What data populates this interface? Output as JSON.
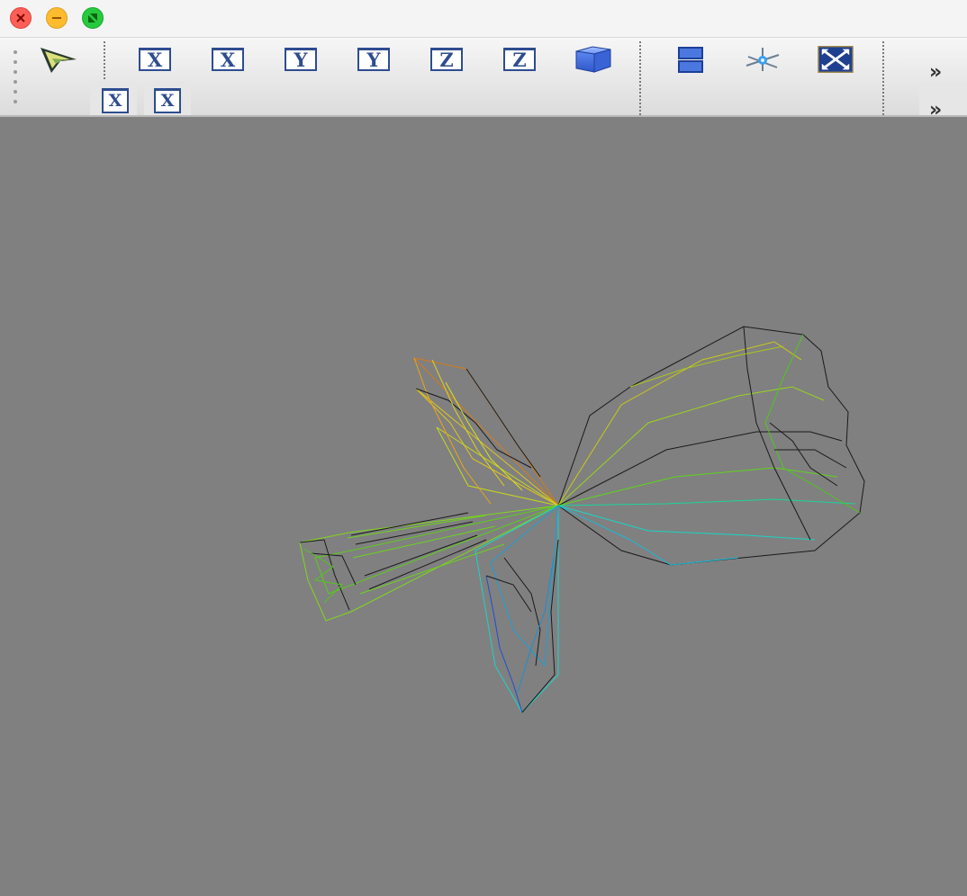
{
  "window": {
    "controls": [
      "close-icon",
      "minimize-icon",
      "maximize-icon"
    ]
  },
  "toolbar": {
    "rotate_x_pos_label": "X",
    "rotate_x_neg_label": "X",
    "rotate_y_pos_label": "Y",
    "rotate_y_neg_label": "Y",
    "rotate_z_pos_label": "Z",
    "rotate_z_neg_label": "Z",
    "extra_x1_label": "X",
    "extra_x2_label": "X",
    "overflow_label": "»",
    "overflow2_label": "»",
    "icons": [
      "cursor-icon",
      "cube-icon",
      "split-view-icon",
      "axes-icon",
      "fit-to-window-icon"
    ]
  },
  "viewport": {
    "background": "#808080",
    "model": "wireframe-mesh"
  }
}
